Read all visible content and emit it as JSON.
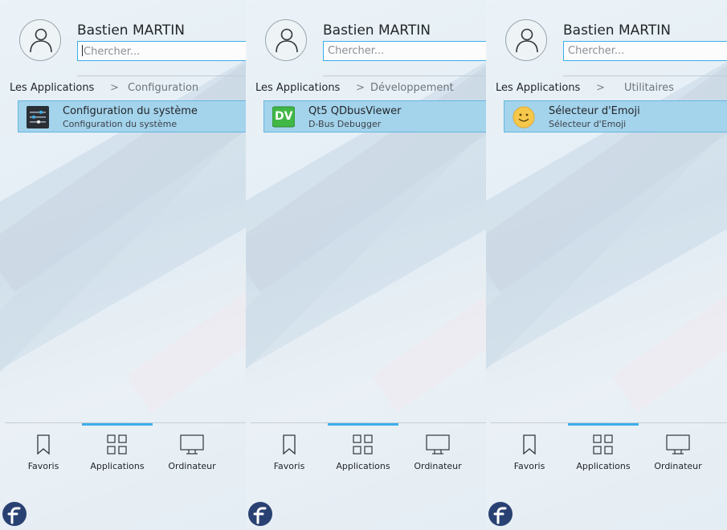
{
  "panels": [
    {
      "username": "Bastien MARTIN",
      "search_placeholder": "Chercher...",
      "breadcrumb_root": "Les Applications",
      "breadcrumb_current": "Configuration",
      "app": {
        "name": "Configuration du système",
        "description": "Configuration du système",
        "icon": "system-settings-icon"
      },
      "tabs": [
        "Favoris",
        "Applications",
        "Ordinateur"
      ],
      "active_tab": "Applications"
    },
    {
      "username": "Bastien MARTIN",
      "search_placeholder": "Chercher...",
      "breadcrumb_root": "Les Applications",
      "breadcrumb_current": "Développement",
      "app": {
        "name": "Qt5 QDbusViewer",
        "description": "D-Bus Debugger",
        "icon": "qdbusviewer-icon",
        "icon_text": "DV"
      },
      "tabs": [
        "Favoris",
        "Applications",
        "Ordinateur"
      ],
      "active_tab": "Applications"
    },
    {
      "username": "Bastien MARTIN",
      "search_placeholder": "Chercher...",
      "breadcrumb_root": "Les Applications",
      "breadcrumb_current": "Utilitaires",
      "app": {
        "name": "Sélecteur d'Emoji",
        "description": "Sélecteur d'Emoji",
        "icon": "emoji-selector-icon"
      },
      "tabs": [
        "Favoris",
        "Applications",
        "Ordinateur"
      ],
      "active_tab": "Applications"
    }
  ],
  "colors": {
    "accent": "#3daee9",
    "highlight": "#a4d3ec",
    "text": "#232629"
  }
}
